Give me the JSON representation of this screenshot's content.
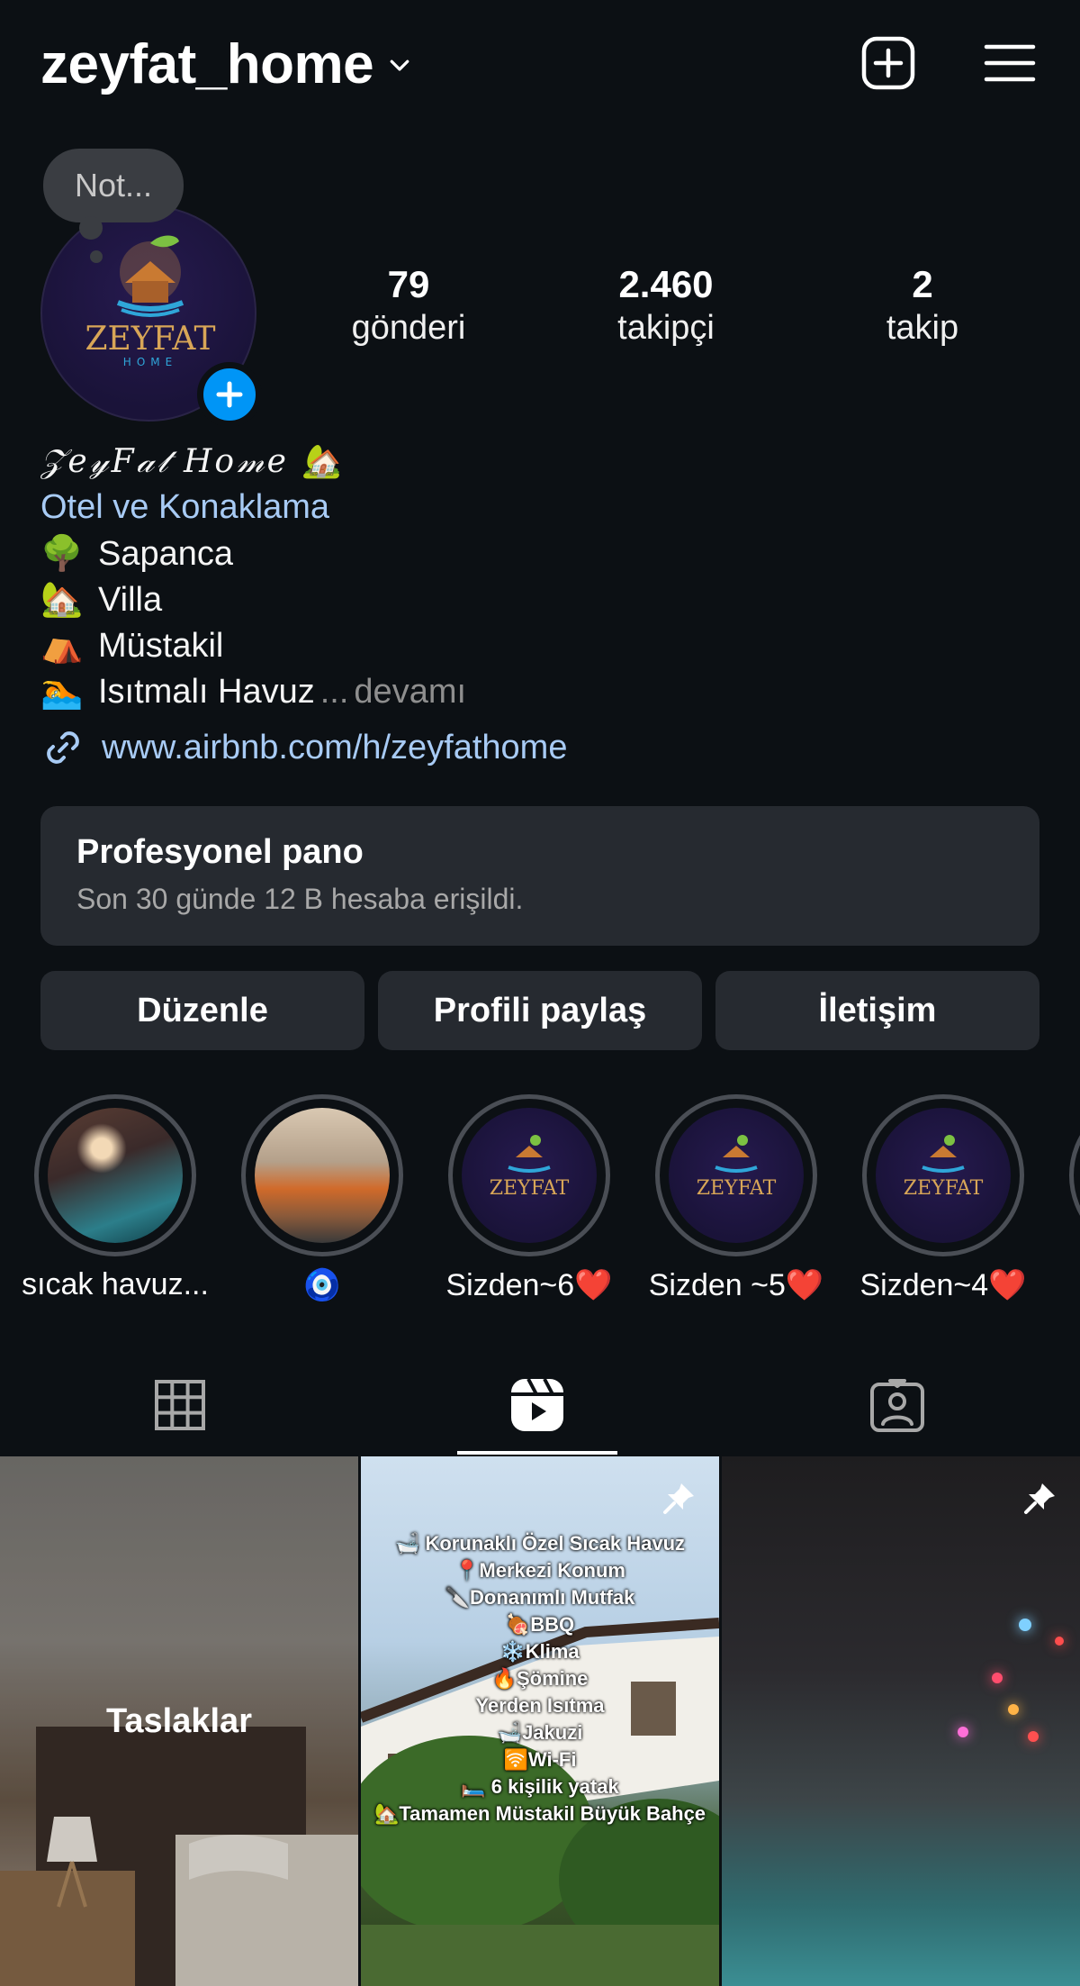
{
  "header": {
    "username": "zeyfat_home",
    "icons": [
      "chevron-down-icon",
      "add-post-icon",
      "menu-icon"
    ]
  },
  "profile": {
    "note_placeholder": "Not...",
    "avatar_brand": "ZEYFAT",
    "avatar_sub": "HOME"
  },
  "stats": [
    {
      "value": "79",
      "label": "gönderi"
    },
    {
      "value": "2.460",
      "label": "takipçi"
    },
    {
      "value": "2",
      "label": "takip"
    }
  ],
  "bio": {
    "display_name": "𝒵𝑒𝓎𝐹𝒶𝓉 𝐻𝑜𝓂𝑒",
    "display_emoji": "🏡",
    "category": "Otel ve Konaklama",
    "lines": [
      {
        "emoji": "🌳",
        "text": "Sapanca"
      },
      {
        "emoji": "🏡",
        "text": "Villa"
      },
      {
        "emoji": "⛺",
        "text": "Müstakil"
      },
      {
        "emoji": "🏊",
        "text": "Isıtmalı Havuz"
      }
    ],
    "more_ellipsis": "...",
    "more_label": "devamı",
    "link": "www.airbnb.com/h/zeyfathome"
  },
  "dashboard": {
    "title": "Profesyonel pano",
    "subtitle": "Son 30 günde 12 B hesaba erişildi."
  },
  "buttons": {
    "edit": "Düzenle",
    "share": "Profili paylaş",
    "contact": "İletişim"
  },
  "highlights": [
    {
      "label": "sıcak havuz..."
    },
    {
      "label": "🧿"
    },
    {
      "label": "Sizden~6❤️"
    },
    {
      "label": "Sizden ~5❤️"
    },
    {
      "label": "Sizden~4❤️"
    }
  ],
  "tabs": [
    "grid-icon",
    "reels-icon",
    "tagged-icon"
  ],
  "grid": {
    "drafts_label": "Taslaklar",
    "reel_lines": [
      "🛁 Korunaklı Özel Sıcak Havuz",
      "📍Merkezi Konum",
      "🔪Donanımlı Mutfak",
      "🍖BBQ",
      "❄️Klima",
      "🔥Şömine",
      "Yerden Isıtma",
      "🛁Jakuzi",
      "🛜Wi-Fi",
      "🛏️ 6 kişilik yatak",
      "🏡Tamamen Müstakil Büyük Bahçe"
    ]
  },
  "colors": {
    "background": "#0c1014",
    "card": "#262a30",
    "link": "#a8cbf5",
    "accent": "#0095f6",
    "muted": "#8e8e8e"
  }
}
